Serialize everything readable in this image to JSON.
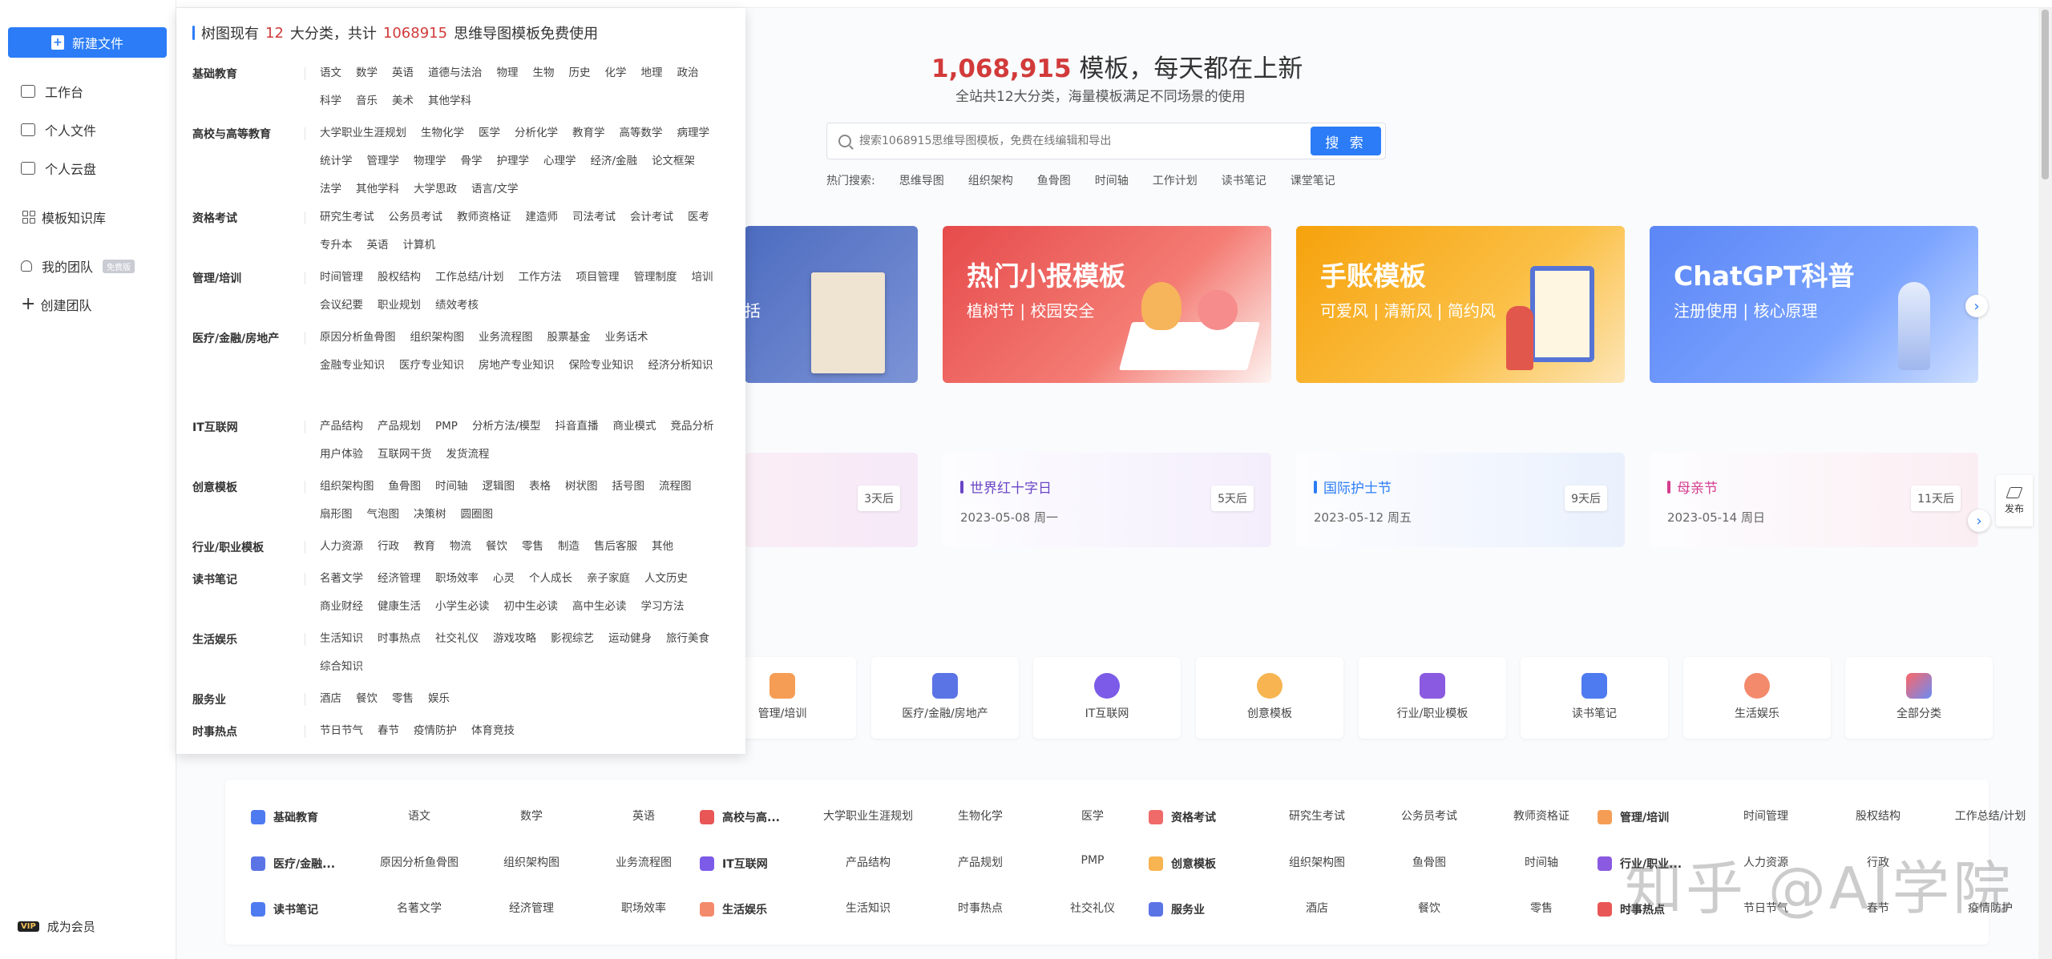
{
  "sidebar": {
    "new_file": "新建文件",
    "items": [
      "工作台",
      "个人文件",
      "个人云盘",
      "模板知识库",
      "我的团队",
      "创建团队"
    ],
    "team_badge": "免费版",
    "vip_tag": "VIP",
    "vip_label": "成为会员"
  },
  "dropdown": {
    "head_prefix": "树图现有",
    "head_count": "12",
    "head_mid": "大分类，共计",
    "head_total": "1068915",
    "head_suffix": "思维导图模板免费使用",
    "groups": [
      {
        "label": "基础教育",
        "items": [
          "语文",
          "数学",
          "英语",
          "道德与法治",
          "物理",
          "生物",
          "历史",
          "化学",
          "地理",
          "政治",
          "科学",
          "音乐",
          "美术",
          "其他学科"
        ]
      },
      {
        "label": "高校与高等教育",
        "items": [
          "大学职业生涯规划",
          "生物化学",
          "医学",
          "分析化学",
          "教育学",
          "高等数学",
          "病理学",
          "统计学",
          "管理学",
          "物理学",
          "骨学",
          "护理学",
          "心理学",
          "经济/金融",
          "论文框架",
          "法学",
          "其他学科",
          "大学思政",
          "语言/文学"
        ]
      },
      {
        "label": "资格考试",
        "items": [
          "研究生考试",
          "公务员考试",
          "教师资格证",
          "建造师",
          "司法考试",
          "会计考试",
          "医考",
          "专升本",
          "英语",
          "计算机"
        ]
      },
      {
        "label": "管理/培训",
        "items": [
          "时间管理",
          "股权结构",
          "工作总结/计划",
          "工作方法",
          "项目管理",
          "管理制度",
          "培训",
          "会议纪要",
          "职业规划",
          "绩效考核"
        ]
      },
      {
        "label": "医疗/金融/房地产",
        "items": [
          "原因分析鱼骨图",
          "组织架构图",
          "业务流程图",
          "股票基金",
          "业务话术",
          "金融专业知识",
          "医疗专业知识",
          "房地产专业知识",
          "保险专业知识",
          "经济分析知识"
        ]
      },
      {
        "label": "IT互联网",
        "items": [
          "产品结构",
          "产品规划",
          "PMP",
          "分析方法/模型",
          "抖音直播",
          "商业模式",
          "竞品分析",
          "用户体验",
          "互联网干货",
          "发货流程"
        ]
      },
      {
        "label": "创意模板",
        "items": [
          "组织架构图",
          "鱼骨图",
          "时间轴",
          "逻辑图",
          "表格",
          "树状图",
          "括号图",
          "流程图",
          "扇形图",
          "气泡图",
          "决策树",
          "圆圈图"
        ]
      },
      {
        "label": "行业/职业模板",
        "items": [
          "人力资源",
          "行政",
          "教育",
          "物流",
          "餐饮",
          "零售",
          "制造",
          "售后客服",
          "其他"
        ]
      },
      {
        "label": "读书笔记",
        "items": [
          "名著文学",
          "经济管理",
          "职场效率",
          "心灵",
          "个人成长",
          "亲子家庭",
          "人文历史",
          "商业财经",
          "健康生活",
          "小学生必读",
          "初中生必读",
          "高中生必读",
          "学习方法"
        ]
      },
      {
        "label": "生活娱乐",
        "items": [
          "生活知识",
          "时事热点",
          "社交礼仪",
          "游戏攻略",
          "影视综艺",
          "运动健身",
          "旅行美食",
          "综合知识"
        ]
      },
      {
        "label": "服务业",
        "items": [
          "酒店",
          "餐饮",
          "零售",
          "娱乐"
        ]
      },
      {
        "label": "时事热点",
        "items": [
          "节日节气",
          "春节",
          "疫情防护",
          "体育竞技"
        ]
      }
    ]
  },
  "hero": {
    "count": "1,068,915",
    "title_rest": " 模板，每天都在上新",
    "subtitle": "全站共12大分类，海量模板满足不同场景的使用",
    "search_placeholder": "搜索1068915思维导图模板，免费在线编辑和导出",
    "search_button": "搜 索",
    "hot_label": "热门搜索:",
    "hot_items": [
      "思维导图",
      "组织架构",
      "鱼骨图",
      "时间轴",
      "工作计划",
      "读书笔记",
      "课堂笔记"
    ]
  },
  "banners": [
    {
      "title": "",
      "subtitle": "括"
    },
    {
      "title": "热门小报模板",
      "subtitle": "植树节 | 校园安全"
    },
    {
      "title": "手账模板",
      "subtitle": "可爱风 | 清新风 | 简约风"
    },
    {
      "title": "ChatGPT科普",
      "subtitle": "注册使用 | 核心原理"
    }
  ],
  "holidays": [
    {
      "name": "",
      "date": "",
      "days": "3天后"
    },
    {
      "name": "世界红十字日",
      "date": "2023-05-08 周一",
      "days": "5天后"
    },
    {
      "name": "国际护士节",
      "date": "2023-05-12 周五",
      "days": "9天后"
    },
    {
      "name": "母亲节",
      "date": "2023-05-14 周日",
      "days": "11天后"
    }
  ],
  "publish": "发布",
  "categories": [
    "管理/培训",
    "医疗/金融/房地产",
    "IT互联网",
    "创意模板",
    "行业/职业模板",
    "读书笔记",
    "生活娱乐",
    "全部分类"
  ],
  "table": {
    "rows": [
      [
        "H:基础教育",
        "语文",
        "数学",
        "英语",
        "H:高校与高...",
        "大学职业生涯规划",
        "生物化学",
        "医学",
        "H:资格考试",
        "研究生考试",
        "公务员考试",
        "教师资格证",
        "H:管理/培训",
        "时间管理",
        "股权结构",
        "工作总结/计划"
      ],
      [
        "H:医疗/金融...",
        "原因分析鱼骨图",
        "组织架构图",
        "业务流程图",
        "H:IT互联网",
        "产品结构",
        "产品规划",
        "PMP",
        "H:创意模板",
        "组织架构图",
        "鱼骨图",
        "时间轴",
        "H:行业/职业...",
        "人力资源",
        "行政",
        ""
      ],
      [
        "H:读书笔记",
        "名著文学",
        "经济管理",
        "职场效率",
        "H:生活娱乐",
        "生活知识",
        "时事热点",
        "社交礼仪",
        "H:服务业",
        "酒店",
        "餐饮",
        "零售",
        "H:时事热点",
        "节日节气",
        "春节",
        "疫情防护"
      ]
    ]
  },
  "watermark": "知乎 @AI学院",
  "colors": {
    "accent": "#2b7cf6",
    "highlight": "#d23a3a"
  }
}
